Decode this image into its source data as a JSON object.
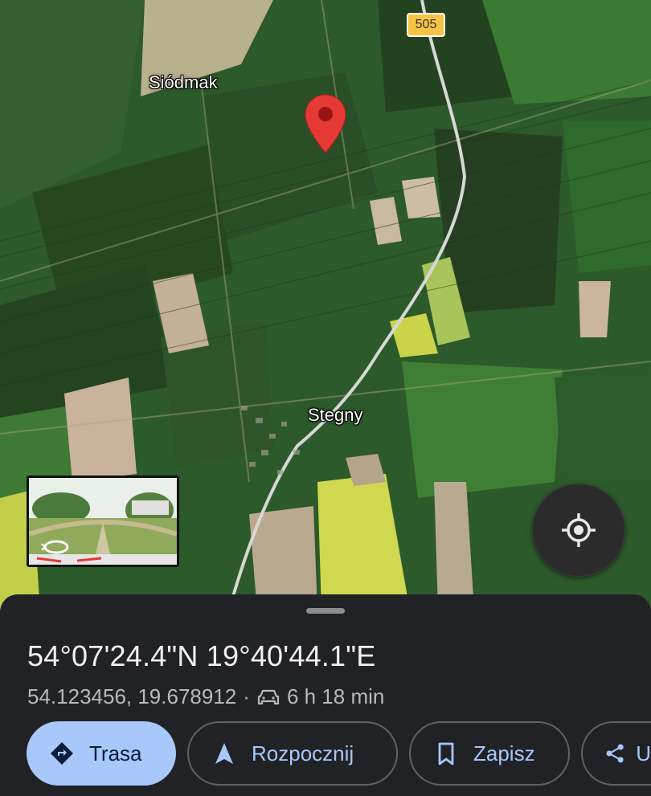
{
  "map": {
    "road_shield": "505",
    "place_labels": [
      "Siódmak",
      "Stegny"
    ],
    "colors": {
      "pin": "#e53935",
      "field_green": "#2f6b2f",
      "rapeseed": "#c8d84a",
      "road": "#d9d9d9"
    }
  },
  "street_view_thumbnail": {
    "icon": "street-view-360-icon"
  },
  "locate_button": {
    "icon": "my-location-icon"
  },
  "sheet": {
    "coordinates_dms": "54°07'24.4\"N 19°40'44.1\"E",
    "coordinates_decimal": "54.123456, 19.678912",
    "separator": "·",
    "drive_time": "6 h 18 min",
    "drive_icon": "car-icon",
    "actions": [
      {
        "label": "Trasa",
        "icon": "directions-icon"
      },
      {
        "label": "Rozpocznij",
        "icon": "navigation-arrow-icon"
      },
      {
        "label": "Zapisz",
        "icon": "bookmark-icon"
      },
      {
        "label": "U",
        "icon": "share-icon"
      }
    ],
    "accent_color": "#a8c7fa"
  }
}
